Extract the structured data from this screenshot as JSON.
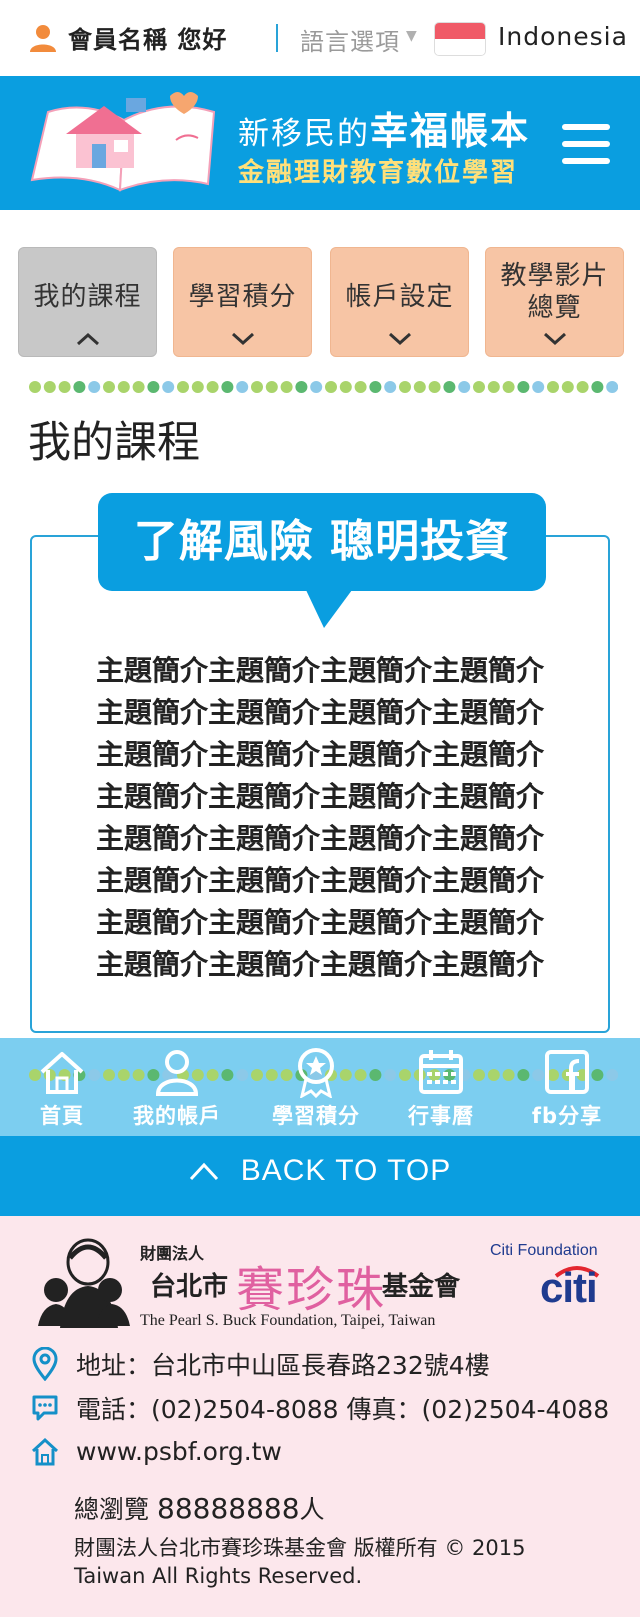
{
  "topbar": {
    "greeting": "會員名稱 您好",
    "language_label": "語言選項",
    "country": "Indonesia"
  },
  "header": {
    "title_prefix": "新移民的",
    "title_main": "幸福帳本",
    "subtitle": "金融理財教育數位學習",
    "logo_text": "幸福帳本"
  },
  "tabs": [
    {
      "label": "我的課程",
      "state": "active"
    },
    {
      "label": "學習積分",
      "state": "collapsed"
    },
    {
      "label": "帳戶設定",
      "state": "collapsed"
    },
    {
      "label": "教學影片總覽",
      "line1": "教學影片",
      "line2": "總覽",
      "state": "collapsed"
    }
  ],
  "page_title": "我的課程",
  "course": {
    "title": "了解風險 聰明投資",
    "intro_lines": [
      "主題簡介主題簡介主題簡介主題簡介",
      "主題簡介主題簡介主題簡介主題簡介",
      "主題簡介主題簡介主題簡介主題簡介",
      "主題簡介主題簡介主題簡介主題簡介",
      "主題簡介主題簡介主題簡介主題簡介",
      "主題簡介主題簡介主題簡介主題簡介",
      "主題簡介主題簡介主題簡介主題簡介",
      "主題簡介主題簡介主題簡介主題簡介"
    ]
  },
  "bottom_nav": [
    {
      "label": "首頁",
      "icon": "home-icon"
    },
    {
      "label": "我的帳戶",
      "icon": "user-icon"
    },
    {
      "label": "學習積分",
      "icon": "badge-icon"
    },
    {
      "label": "行事曆",
      "icon": "calendar-icon"
    },
    {
      "label": "fb分享",
      "icon": "facebook-icon"
    }
  ],
  "back_to_top": "BACK TO TOP",
  "footer": {
    "org_prefix": "財團法人",
    "org_city": "台北市",
    "org_name": "賽珍珠",
    "org_suffix": "基金會",
    "org_english": "The Pearl S. Buck Foundation, Taipei, Taiwan",
    "sponsor_label": "Citi Foundation",
    "sponsor_logo": "citi",
    "address": "地址：台北市中山區長春路232號4樓",
    "phone": "電話：(02)2504-8088   傳真：(02)2504-4088",
    "website": "www.psbf.org.tw",
    "visits_label": "總瀏覽",
    "visits_count": "88888888",
    "visits_unit": "人",
    "copyright": "財團法人台北市賽珍珠基金會 版權所有 © 2015 Taiwan All Rights Reserved."
  },
  "colors": {
    "brand_blue": "#0a9ee0",
    "nav_blue": "#7ccef0",
    "tab_active": "#c8c8c8",
    "tab_normal": "#f7c5a5",
    "subtitle_yellow": "#ffe07a",
    "footer_pink": "#fce7ec"
  }
}
